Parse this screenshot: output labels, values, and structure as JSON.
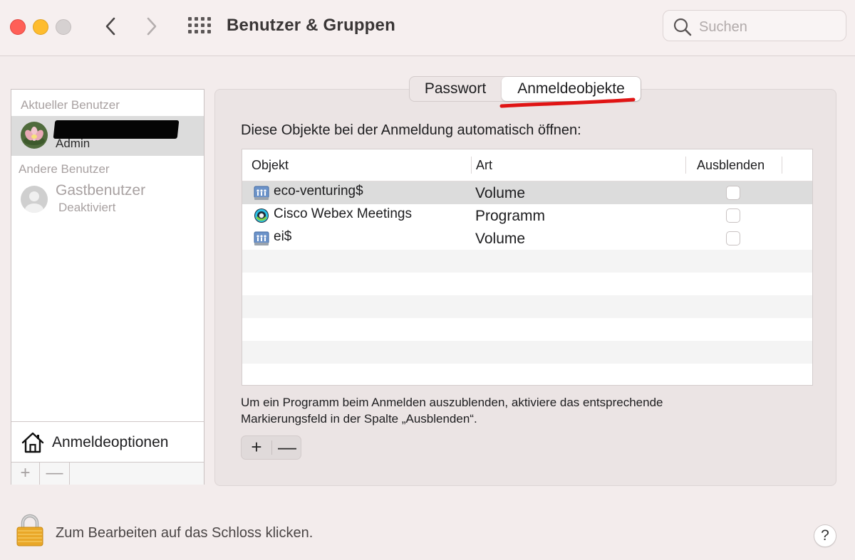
{
  "window": {
    "title": "Benutzer & Gruppen",
    "search_placeholder": "Suchen"
  },
  "sidebar": {
    "current_users_label": "Aktueller Benutzer",
    "current_user": {
      "role": "Admin"
    },
    "other_users_label": "Andere Benutzer",
    "other_users": [
      {
        "name": "Gastbenutzer",
        "status": "Deaktiviert"
      }
    ],
    "login_options_label": "Anmeldeoptionen",
    "add_label": "+",
    "remove_label": "—"
  },
  "tabs": [
    {
      "label": "Passwort",
      "selected": false
    },
    {
      "label": "Anmeldeobjekte",
      "selected": true
    }
  ],
  "main": {
    "intro": "Diese Objekte bei der Anmeldung automatisch öffnen:",
    "columns": {
      "object": "Objekt",
      "kind": "Art",
      "hide": "Ausblenden"
    },
    "items": [
      {
        "name": "eco-venturing$",
        "kind": "Volume",
        "icon": "network-volume-icon",
        "hidden": false,
        "selected": true
      },
      {
        "name": "Cisco Webex Meetings",
        "kind": "Programm",
        "icon": "webex-app-icon",
        "hidden": false,
        "selected": false
      },
      {
        "name": "ei$",
        "kind": "Volume",
        "icon": "network-volume-icon",
        "hidden": false,
        "selected": false
      }
    ],
    "hint_line1": "Um ein Programm beim Anmelden auszublenden, aktiviere das entsprechende",
    "hint_line2": "Markierungsfeld in der Spalte „Ausblenden“.",
    "add_label": "+",
    "remove_label": "—"
  },
  "footer": {
    "lock_text": "Zum Bearbeiten auf das Schloss klicken.",
    "help_label": "?"
  },
  "colors": {
    "window_bg": "#f3ecec",
    "selection_gray": "#dcdcdc",
    "annotation_red": "#e01414"
  }
}
